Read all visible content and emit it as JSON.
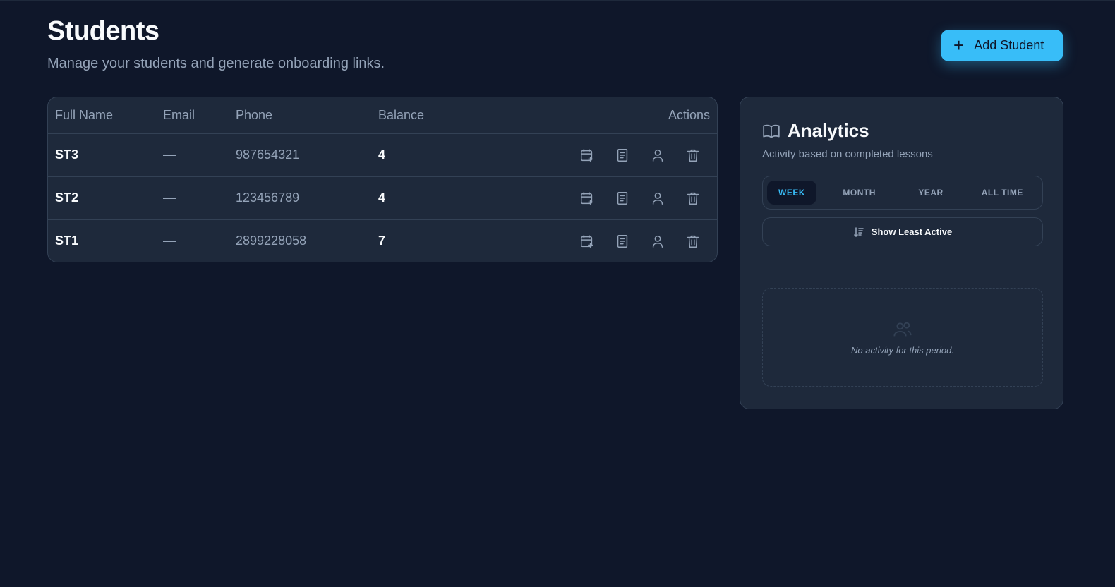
{
  "header": {
    "title": "Students",
    "subtitle": "Manage your students and generate onboarding links.",
    "add_button_label": "Add Student"
  },
  "table": {
    "columns": [
      "Full Name",
      "Email",
      "Phone",
      "Balance",
      "Actions"
    ],
    "rows": [
      {
        "name": "ST3",
        "email": "—",
        "phone": "987654321",
        "balance": "4"
      },
      {
        "name": "ST2",
        "email": "—",
        "phone": "123456789",
        "balance": "4"
      },
      {
        "name": "ST1",
        "email": "—",
        "phone": "2899228058",
        "balance": "7"
      }
    ],
    "row_actions": [
      "calendar-plus-icon",
      "notes-icon",
      "user-icon",
      "trash-icon"
    ]
  },
  "analytics": {
    "title": "Analytics",
    "subtitle": "Activity based on completed lessons",
    "tabs": [
      "WEEK",
      "MONTH",
      "YEAR",
      "ALL TIME"
    ],
    "active_tab": "WEEK",
    "least_active_label": "Show Least Active",
    "empty_text": "No activity for this period."
  },
  "colors": {
    "background": "#0f172a",
    "card": "#1e293b",
    "accent": "#38bdf8",
    "border": "#334155"
  }
}
